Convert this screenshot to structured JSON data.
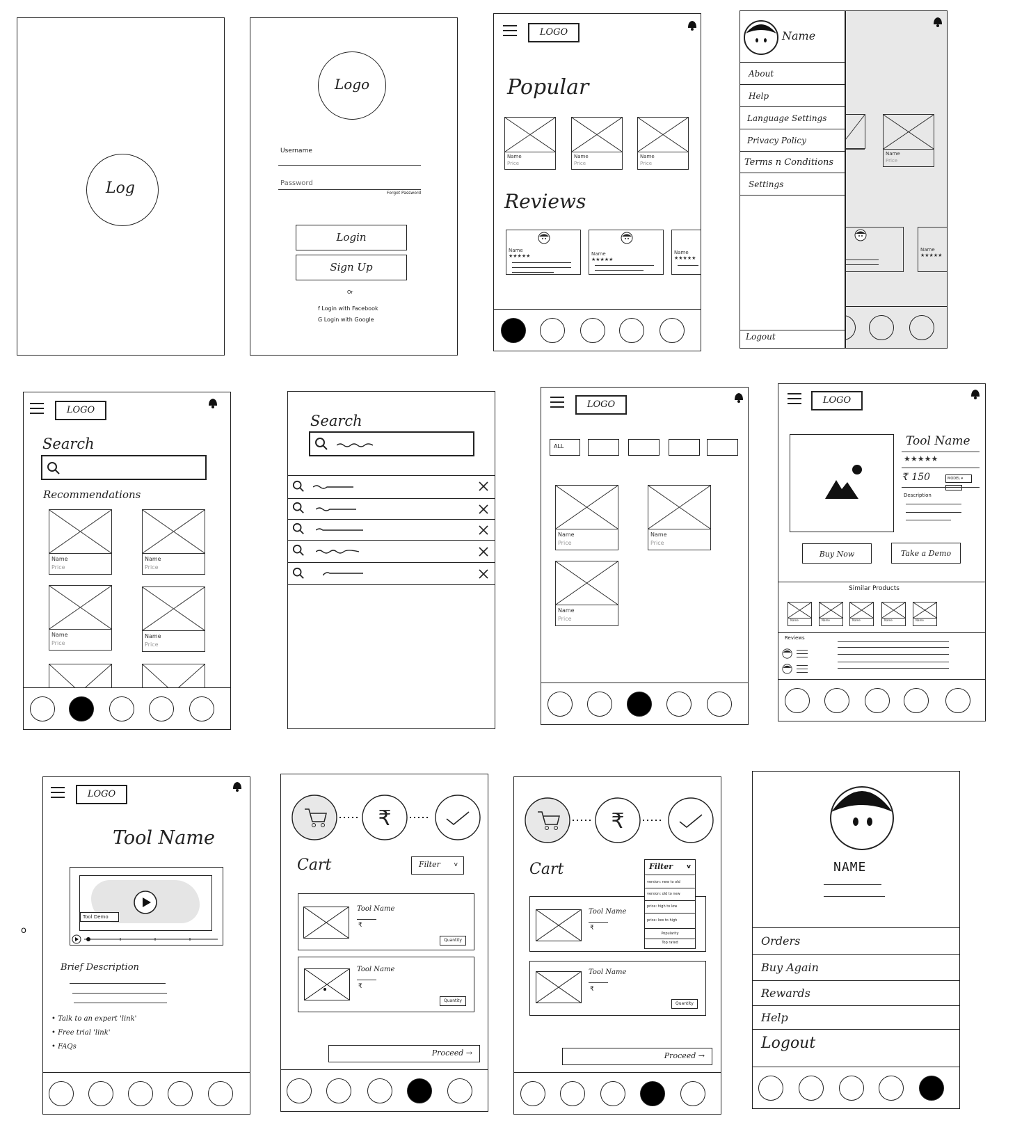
{
  "screens": {
    "splash": {
      "logo_text": "Log"
    },
    "login": {
      "logo_text": "Logo",
      "username_label": "Username",
      "password_label": "Password",
      "forgot_label": "Forgot Password",
      "login_label": "Login",
      "signup_label": "Sign Up",
      "or_label": "Or",
      "facebook_label": "f Login with Facebook",
      "google_label": "G Login with Google"
    },
    "home": {
      "logo_text": "LOGO",
      "popular_title": "Popular",
      "reviews_title": "Reviews",
      "card_name": "Name",
      "card_price": "Price",
      "stars": "★★★★★"
    },
    "drawer": {
      "user_name": "Name",
      "items": [
        "About",
        "Help",
        "Language Settings",
        "Privacy Policy",
        "Terms n Conditions",
        "Settings"
      ],
      "logout_label": "Logout"
    },
    "search_home": {
      "logo_text": "LOGO",
      "search_title": "Search",
      "recommendations_title": "Recommendations",
      "card_name": "Name",
      "card_price": "Price"
    },
    "search_results": {
      "search_title": "Search"
    },
    "catalog": {
      "logo_text": "LOGO",
      "filter_all": "ALL",
      "card_name": "Name",
      "card_price": "Price"
    },
    "product": {
      "logo_text": "LOGO",
      "tool_name": "Tool Name",
      "stars": "★★★★★",
      "price": "₹ 150",
      "model_label": "MODEL",
      "description_label": "Description",
      "buy_now_label": "Buy Now",
      "demo_label": "Take a Demo",
      "similar_title": "Similar Products",
      "reviews_title": "Reviews",
      "card_name": "Name",
      "card_price": "Price"
    },
    "tool_detail": {
      "logo_text": "LOGO",
      "tool_name": "Tool Name",
      "demo_tag": "Tool Demo",
      "brief_title": "Brief Description",
      "bullets": [
        "Talk to an expert 'link'",
        "Free trial 'link'",
        "FAQs"
      ]
    },
    "cart": {
      "title": "Cart",
      "filter_label": "Filter",
      "item_name": "Tool Name",
      "currency": "₹",
      "quantity_label": "Quantity",
      "proceed_label": "Proceed →"
    },
    "cart_filter": {
      "title": "Cart",
      "filter_label": "Filter",
      "options": [
        "version: new to old",
        "version: old to new",
        "price: high to low",
        "price: low to high",
        "Popularity",
        "Top rated"
      ],
      "item_name": "Tool Name",
      "currency": "₹",
      "quantity_label": "Quantity",
      "proceed_label": "Proceed →"
    },
    "profile": {
      "name": "NAME",
      "items": [
        "Orders",
        "Buy Again",
        "Rewards",
        "Help",
        "Logout"
      ]
    }
  },
  "misc": {
    "stray_mark": "o"
  },
  "colors": {
    "ink": "#222222",
    "shade": "#e8e8e8",
    "muted": "#999999"
  }
}
